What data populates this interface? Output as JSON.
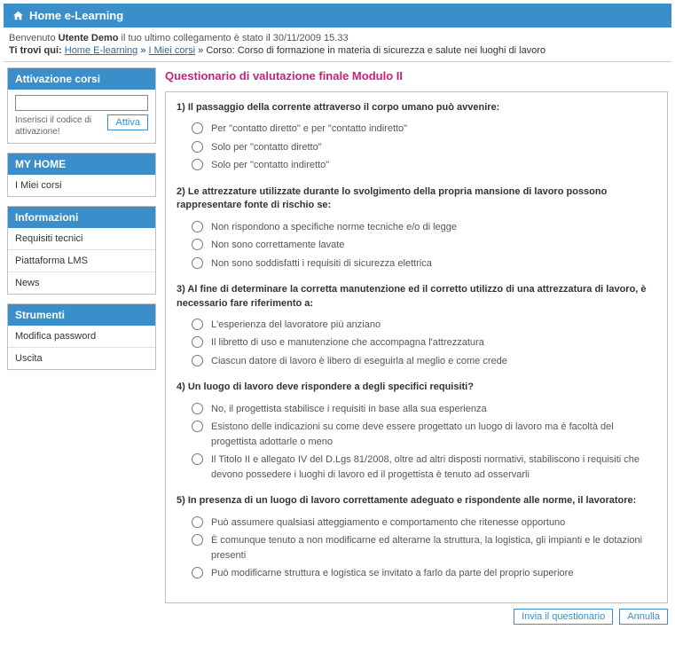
{
  "header": {
    "title": "Home e-Learning"
  },
  "welcome": {
    "prefix": "Benvenuto ",
    "username": "Utente Demo",
    "last_login_text": " il tuo ultimo collegamento è stato il 30/11/2009 15.33"
  },
  "breadcrumb": {
    "label": "Ti trovi qui:",
    "home": "Home E-learning",
    "courses": "I Miei corsi",
    "course_prefix": "Corso: ",
    "course_name": "Corso di formazione in materia di sicurezza e salute nei luoghi di lavoro",
    "sep": " » "
  },
  "sidebar": {
    "activation": {
      "title": "Attivazione corsi",
      "help": "Inserisci il codice di attivazione!",
      "button": "Attiva"
    },
    "myhome": {
      "title": "MY HOME",
      "items": [
        "I Miei corsi"
      ]
    },
    "info": {
      "title": "Informazioni",
      "items": [
        "Requisiti tecnici",
        "Piattaforma LMS",
        "News"
      ]
    },
    "tools": {
      "title": "Strumenti",
      "items": [
        "Modifica password",
        "Uscita"
      ]
    }
  },
  "quiz": {
    "title": "Questionario di valutazione finale Modulo II",
    "questions": [
      {
        "num": "1)",
        "text": "Il passaggio della corrente attraverso il corpo umano può avvenire:",
        "options": [
          "Per \"contatto diretto\" e per \"contatto indiretto\"",
          "Solo per \"contatto diretto\"",
          "Solo per \"contatto indiretto\""
        ]
      },
      {
        "num": "2)",
        "text": "Le attrezzature utilizzate durante lo svolgimento della propria mansione di lavoro possono rappresentare fonte di rischio se:",
        "options": [
          "Non rispondono a specifiche norme tecniche e/o di legge",
          "Non sono correttamente lavate",
          "Non sono soddisfatti i requisiti di sicurezza elettrica"
        ]
      },
      {
        "num": "3)",
        "text": "Al fine di determinare la corretta manutenzione ed il corretto utilizzo di una attrezzatura di lavoro, è necessario fare riferimento a:",
        "options": [
          "L'esperienza del lavoratore più anziano",
          "Il libretto di uso e manutenzione che accompagna l'attrezzatura",
          "Ciascun datore di lavoro è libero di eseguirla al meglio e come crede"
        ]
      },
      {
        "num": "4)",
        "text": "Un luogo di lavoro deve rispondere a degli specifici requisiti?",
        "options": [
          "No, il progettista stabilisce i requisiti in base alla sua esperienza",
          "Esistono delle indicazioni su come deve essere progettato un luogo di lavoro ma è facoltà del progettista adottarle o meno",
          "Il Titolo II e allegato IV del D.Lgs 81/2008, oltre ad altri disposti normativi, stabiliscono i requisiti che devono possedere i luoghi di lavoro ed il progettista è tenuto ad osservarli"
        ]
      },
      {
        "num": "5)",
        "text": "In presenza di un luogo di lavoro correttamente adeguato e rispondente alle norme, il lavoratore:",
        "options": [
          "Può assumere qualsiasi atteggiamento e comportamento che ritenesse opportuno",
          "È comunque tenuto a non modificarne ed alterarne la struttura, la logistica, gli impianti e le dotazioni presenti",
          "Può modificarne struttura e logistica se invitato a farlo da parte del proprio superiore"
        ]
      }
    ],
    "submit": "Invia il questionario",
    "cancel": "Annulla"
  }
}
